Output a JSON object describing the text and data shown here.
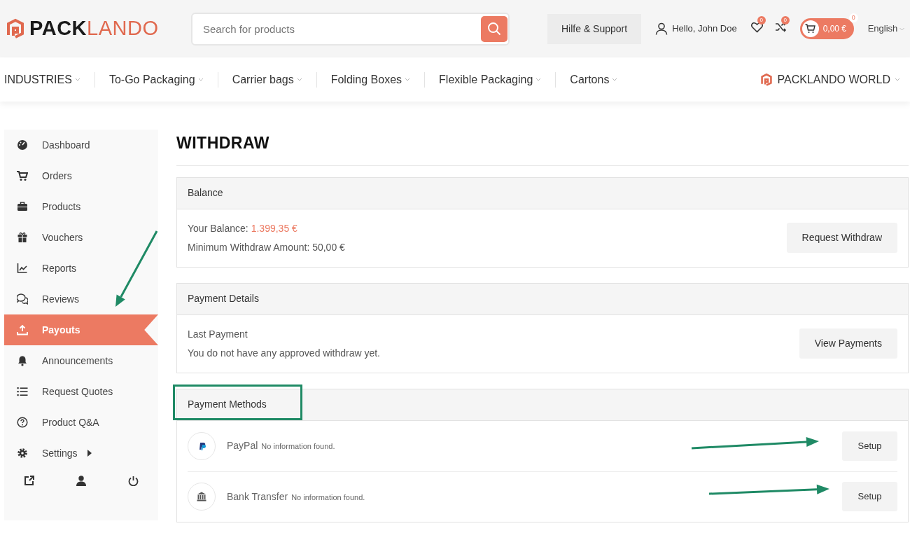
{
  "header": {
    "logo": {
      "dark_part": "PACK",
      "accent_part": "LANDO"
    },
    "search": {
      "placeholder": "Search for products"
    },
    "help_button": "Hilfe & Support",
    "account": "Hello, John Doe",
    "wishlist_count": "0",
    "compare_count": "0",
    "cart": {
      "total": "0,00 €",
      "count": "0"
    },
    "language": "English"
  },
  "nav": {
    "items": [
      {
        "label": "INDUSTRIES"
      },
      {
        "label": "To-Go Packaging"
      },
      {
        "label": "Carrier bags"
      },
      {
        "label": "Folding Boxes"
      },
      {
        "label": "Flexible Packaging"
      },
      {
        "label": "Cartons"
      }
    ],
    "world": "PACKLANDO WORLD"
  },
  "sidebar": {
    "items": [
      {
        "label": "Dashboard",
        "selected": false,
        "submenu": false
      },
      {
        "label": "Orders",
        "selected": false,
        "submenu": false
      },
      {
        "label": "Products",
        "selected": false,
        "submenu": false
      },
      {
        "label": "Vouchers",
        "selected": false,
        "submenu": false
      },
      {
        "label": "Reports",
        "selected": false,
        "submenu": false
      },
      {
        "label": "Reviews",
        "selected": false,
        "submenu": false
      },
      {
        "label": "Payouts",
        "selected": true,
        "submenu": false
      },
      {
        "label": "Announcements",
        "selected": false,
        "submenu": false
      },
      {
        "label": "Request Quotes",
        "selected": false,
        "submenu": false
      },
      {
        "label": "Product Q&A",
        "selected": false,
        "submenu": false
      },
      {
        "label": "Settings",
        "selected": false,
        "submenu": true
      }
    ]
  },
  "main": {
    "title": "WITHDRAW",
    "balance": {
      "heading": "Balance",
      "balance_label": "Your Balance:",
      "balance_amount": "1.399,35 €",
      "minimum": "Minimum Withdraw Amount: 50,00 €",
      "button": "Request Withdraw"
    },
    "payment_details": {
      "heading": "Payment Details",
      "last_payment_label": "Last Payment",
      "message": "You do not have any approved withdraw yet.",
      "button": "View Payments"
    },
    "payment_methods": {
      "heading": "Payment Methods",
      "methods": [
        {
          "name": "PayPal",
          "note": "No information found.",
          "button": "Setup"
        },
        {
          "name": "Bank Transfer",
          "note": "No information found.",
          "button": "Setup"
        }
      ]
    }
  }
}
